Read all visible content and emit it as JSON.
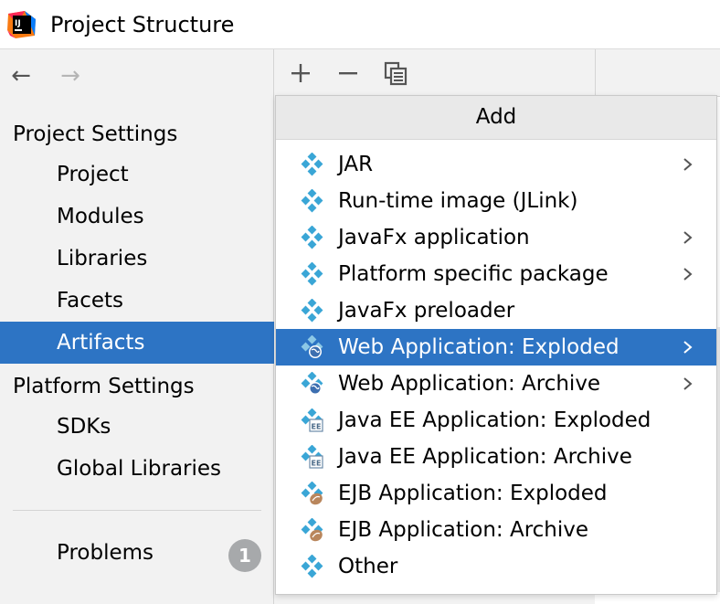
{
  "window": {
    "title": "Project Structure"
  },
  "colors": {
    "accent": "#2d74c4",
    "icon_diamond": "#3aa6d6",
    "badge": "#a7a9ab"
  },
  "sidebar": {
    "project_settings_header": "Project Settings",
    "project_items": [
      "Project",
      "Modules",
      "Libraries",
      "Facets",
      "Artifacts"
    ],
    "selected_item": "Artifacts",
    "platform_settings_header": "Platform Settings",
    "platform_items": [
      "SDKs",
      "Global Libraries"
    ],
    "problems": {
      "label": "Problems",
      "count": "1"
    }
  },
  "toolbar": {
    "add_icon": "plus-icon",
    "remove_icon": "minus-icon",
    "copy_icon": "copy-icon"
  },
  "popup": {
    "title": "Add",
    "items": [
      {
        "label": "JAR",
        "icon": "artifact-icon",
        "submenu": true
      },
      {
        "label": "Run-time image (JLink)",
        "icon": "artifact-icon",
        "submenu": false
      },
      {
        "label": "JavaFx application",
        "icon": "artifact-icon",
        "submenu": true
      },
      {
        "label": "Platform specific package",
        "icon": "artifact-icon",
        "submenu": true
      },
      {
        "label": "JavaFx preloader",
        "icon": "artifact-icon",
        "submenu": false
      },
      {
        "label": "Web Application: Exploded",
        "icon": "web-artifact-icon",
        "submenu": true,
        "selected": true
      },
      {
        "label": "Web Application: Archive",
        "icon": "web-artifact-icon",
        "submenu": true
      },
      {
        "label": "Java EE Application: Exploded",
        "icon": "javaee-artifact-icon",
        "submenu": false
      },
      {
        "label": "Java EE Application: Archive",
        "icon": "javaee-artifact-icon",
        "submenu": false
      },
      {
        "label": "EJB Application: Exploded",
        "icon": "ejb-artifact-icon",
        "submenu": false
      },
      {
        "label": "EJB Application: Archive",
        "icon": "ejb-artifact-icon",
        "submenu": false
      },
      {
        "label": "Other",
        "icon": "artifact-icon",
        "submenu": false
      }
    ]
  }
}
